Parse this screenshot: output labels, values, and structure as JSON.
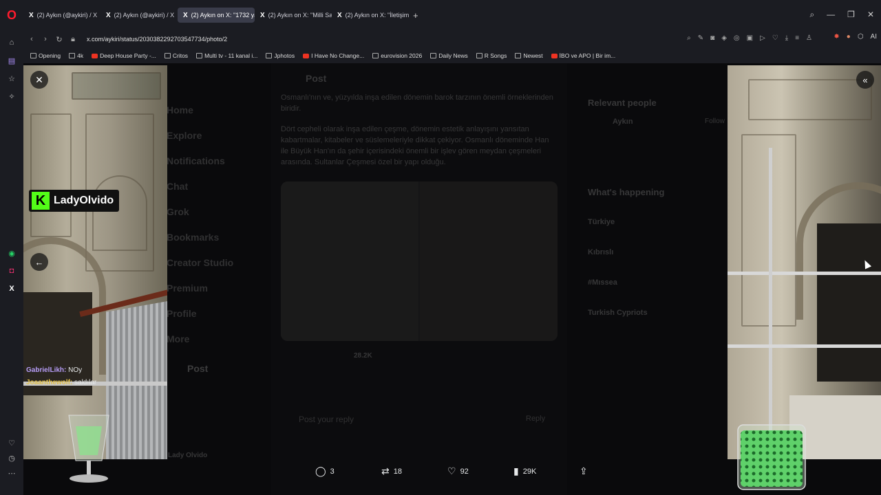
{
  "browser": {
    "tabs": [
      {
        "label": "(2) Aykın (@aykiri) / X",
        "active": false
      },
      {
        "label": "(2) Aykın (@aykiri) / X",
        "active": false
      },
      {
        "label": "(2) Aykın on X: \"1732 yap",
        "active": true
      },
      {
        "label": "(2) Aykın on X: \"Milli Savu",
        "active": false
      },
      {
        "label": "(2) Aykın on X: \"İletişim Ba",
        "active": false
      }
    ],
    "new_tab_label": "+",
    "url": "x.com/aykiri/status/2030382292703547734/photo/2",
    "ai_label": "AI",
    "bookmarks": [
      {
        "label": "Opening",
        "icon": "folder"
      },
      {
        "label": "4k",
        "icon": "folder"
      },
      {
        "label": "Deep House Party -...",
        "icon": "youtube"
      },
      {
        "label": "Critos",
        "icon": "folder"
      },
      {
        "label": "Multi tv - 11 kanal i...",
        "icon": "site"
      },
      {
        "label": "Jphotos",
        "icon": "site"
      },
      {
        "label": "I Have No Change...",
        "icon": "youtube"
      },
      {
        "label": "eurovision 2026",
        "icon": "folder"
      },
      {
        "label": "Daily News",
        "icon": "folder"
      },
      {
        "label": "R Songs",
        "icon": "folder"
      },
      {
        "label": "Newest",
        "icon": "folder"
      },
      {
        "label": "İBO ve APO | Bir im...",
        "icon": "youtube"
      }
    ]
  },
  "background_post": {
    "header": "Post",
    "nav": [
      "Home",
      "Explore",
      "Notifications",
      "Chat",
      "Grok",
      "Bookmarks",
      "Creator Studio",
      "Premium",
      "Profile",
      "More"
    ],
    "post_button": "Post",
    "paragraph_1": "Osmanlı'nın ve, yüzyılda inşa edilen dönemin barok tarzının önemli örneklerinden biridir.",
    "paragraph_2": "Dört cepheli olarak inşa edilen çeşme, dönemin estetik anlayışını yansıtan kabartmalar, kitabeler ve süslemeleriyle dikkat çekiyor. Osmanlı döneminde Han ile Büyük Han'ın da şehir içerisindeki önemli bir işlev gören meydan çeşmeleri arasında. Sultanlar Çeşmesi özel bir yapı olduğu.",
    "views": "28.2K",
    "reply_placeholder": "Post your reply",
    "reply_button": "Reply",
    "account_name": "Lady Olvido",
    "right_panel": {
      "relevant_title": "Relevant people",
      "person_name": "Aykın",
      "follow_label": "Follow",
      "happening_title": "What's happening",
      "trends": [
        "Türkiye",
        "Kıbrıslı",
        "#Mıssea",
        "Turkish Cypriots"
      ]
    }
  },
  "overlay": {
    "kick_logo": "K",
    "kick_name": "LadyOlvido",
    "chat": [
      {
        "user": "GabrielLikh:",
        "message": "NOy"
      },
      {
        "user": "Joaanthewolf:",
        "message": "saldılar"
      }
    ]
  },
  "photo_actions": {
    "replies": "3",
    "reposts": "18",
    "likes": "92",
    "views": "29K"
  },
  "colors": {
    "accent_kick": "#53fc18",
    "opera_red": "#ff1b2d",
    "chat_user1": "#b59cf5",
    "chat_user2": "#e2c04a"
  }
}
